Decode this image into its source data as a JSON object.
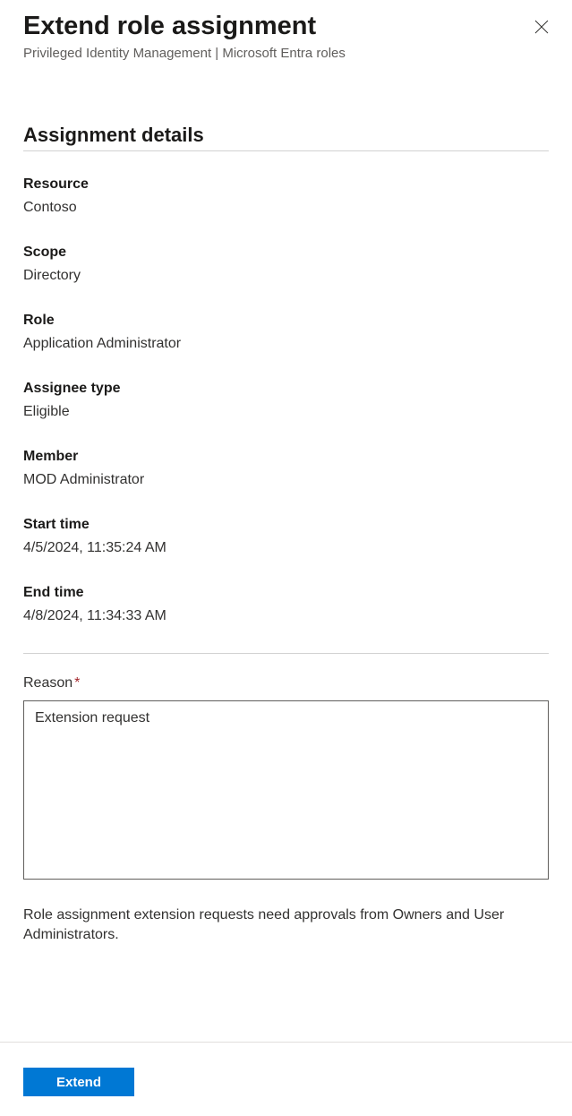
{
  "header": {
    "title": "Extend role assignment",
    "subtitle": "Privileged Identity Management | Microsoft Entra roles"
  },
  "section_title": "Assignment details",
  "details": {
    "resource": {
      "label": "Resource",
      "value": "Contoso"
    },
    "scope": {
      "label": "Scope",
      "value": "Directory"
    },
    "role": {
      "label": "Role",
      "value": "Application Administrator"
    },
    "assignee_type": {
      "label": "Assignee type",
      "value": "Eligible"
    },
    "member": {
      "label": "Member",
      "value": "MOD Administrator"
    },
    "start_time": {
      "label": "Start time",
      "value": "4/5/2024, 11:35:24 AM"
    },
    "end_time": {
      "label": "End time",
      "value": "4/8/2024, 11:34:33 AM"
    }
  },
  "form": {
    "reason_label": "Reason",
    "reason_value": "Extension request",
    "helper_text": "Role assignment extension requests need approvals from Owners and User Administrators."
  },
  "footer": {
    "extend_label": "Extend"
  }
}
